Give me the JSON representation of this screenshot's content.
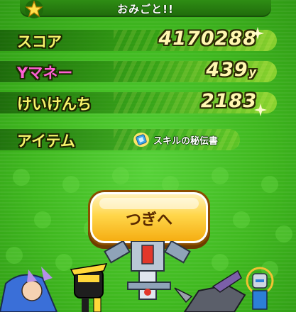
{
  "header": {
    "title": "おみごと!!",
    "icon": "star-icon"
  },
  "stats": {
    "score": {
      "label": "スコア",
      "value": "4170288",
      "label_color": "#f7f36a"
    },
    "money": {
      "label": "Yマネー",
      "value": "439",
      "unit": "y",
      "label_color": "#ff5fd4"
    },
    "exp": {
      "label": "けいけんち",
      "value": "2183",
      "label_color": "#f7f36a"
    }
  },
  "item": {
    "label": "アイテム",
    "icon": "scroll-icon",
    "name": "スキルの秘伝書"
  },
  "next_button": {
    "label": "つぎへ"
  },
  "colors": {
    "background": "#3fb81f",
    "button": "#ffd64a",
    "value_text": "#fff7b0"
  }
}
